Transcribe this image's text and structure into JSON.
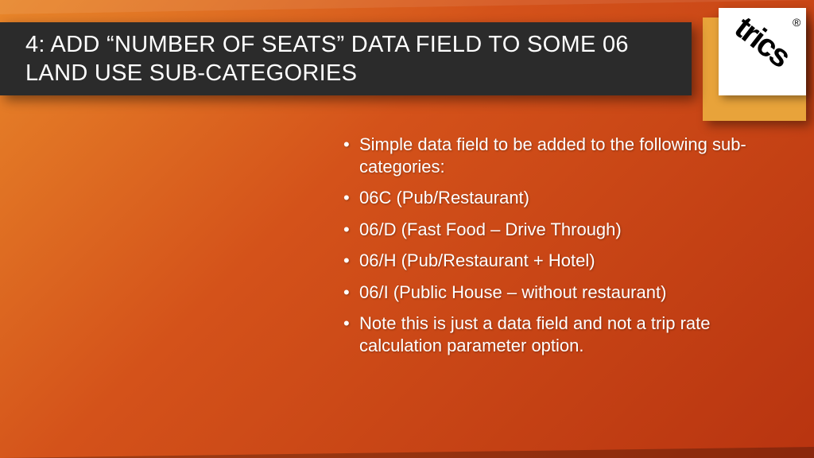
{
  "title": "4: ADD “NUMBER OF SEATS” DATA FIELD TO SOME 06 LAND USE SUB-CATEGORIES",
  "logo": {
    "text": "trics",
    "registered": "®"
  },
  "bullets": [
    "Simple data field to be added to the following sub-categories:",
    "06C (Pub/Restaurant)",
    "06/D (Fast Food – Drive Through)",
    "06/H (Pub/Restaurant + Hotel)",
    "06/I (Public House – without restaurant)",
    "Note this is just a data field and not a trip rate calculation parameter option."
  ]
}
